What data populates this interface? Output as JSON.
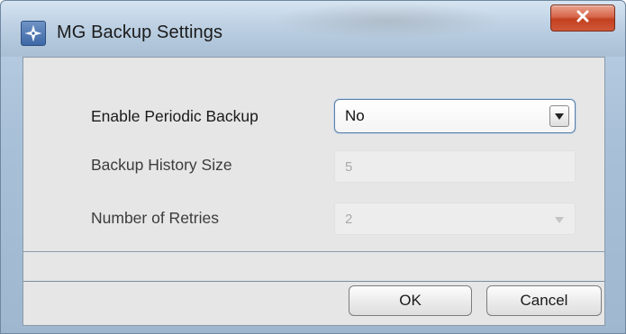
{
  "window": {
    "title": "MG Backup Settings",
    "close_symbol": "X",
    "icons": {
      "app": "compass-icon",
      "close": "close-icon"
    }
  },
  "form": {
    "enable_periodic_backup": {
      "label": "Enable Periodic Backup",
      "value": "No",
      "enabled": true
    },
    "backup_history_size": {
      "label": "Backup History Size",
      "value": "5",
      "enabled": false
    },
    "number_of_retries": {
      "label": "Number of Retries",
      "value": "2",
      "enabled": false
    }
  },
  "buttons": {
    "ok_label": "OK",
    "cancel_label": "Cancel"
  },
  "colors": {
    "title_bar": "#b3c8dc",
    "close_button": "#c2401f",
    "panel": "#e6e6e6",
    "focus_border": "#5e7fa6"
  }
}
